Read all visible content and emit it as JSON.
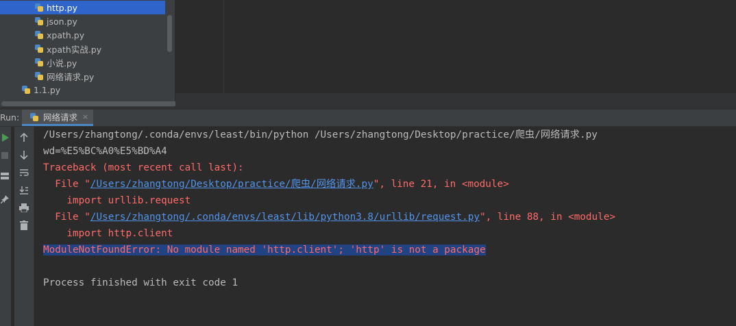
{
  "project_tree": {
    "files": [
      {
        "name": "http.py",
        "selected": true
      },
      {
        "name": "json.py",
        "selected": false
      },
      {
        "name": "xpath.py",
        "selected": false
      },
      {
        "name": "xpath实战.py",
        "selected": false
      },
      {
        "name": "小说.py",
        "selected": false
      },
      {
        "name": "网络请求.py",
        "selected": false
      },
      {
        "name": "1.1.py",
        "selected": false
      }
    ]
  },
  "run_panel": {
    "label": "Run:",
    "tab_label": "网络请求",
    "tab_close": "×"
  },
  "console": {
    "command_line": "/Users/zhangtong/.conda/envs/least/bin/python /Users/zhangtong/Desktop/practice/爬虫/网络请求.py",
    "output_line": "wd=%E5%BC%A0%E5%BD%A4",
    "traceback_header": "Traceback (most recent call last):",
    "frame1": {
      "prefix": "  File \"",
      "path": "/Users/zhangtong/Desktop/practice/爬虫/网络请求.py",
      "suffix": "\", line 21, in <module>",
      "code": "    import urllib.request"
    },
    "frame2": {
      "prefix": "  File \"",
      "path": "/Users/zhangtong/.conda/envs/least/lib/python3.8/urllib/request.py",
      "suffix": "\", line 88, in <module>",
      "code": "    import http.client"
    },
    "error_message": "ModuleNotFoundError: No module named 'http.client'; 'http' is not a package",
    "exit_message": "Process finished with exit code 1"
  },
  "colors": {
    "selection": "#2f65ca",
    "error": "#ff6b68",
    "link": "#5394ec",
    "highlight": "#214283",
    "run_green": "#499c54"
  }
}
